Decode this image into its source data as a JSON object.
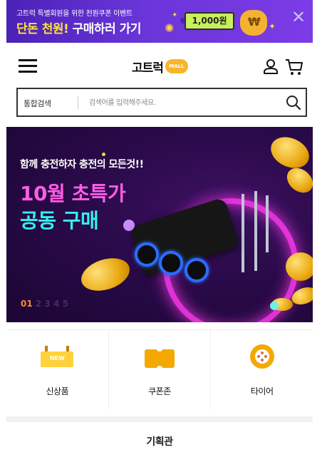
{
  "promo": {
    "sub": "고트럭 특별회원을 위한 천원쿠폰 이벤트",
    "main_prefix": "단돈 천원!",
    "main_suffix": " 구매하러 가기",
    "coupon_amount": "1,000원",
    "close_icon": "close-icon"
  },
  "header": {
    "logo_text": "고트럭",
    "logo_badge": "MALL",
    "icons": [
      "menu-icon",
      "user-icon",
      "cart-icon"
    ]
  },
  "search": {
    "scope": "통합검색",
    "placeholder": "검색어를 입력해주세요.",
    "value": "",
    "icon": "search-icon"
  },
  "hero": {
    "tagline": "함께 충전하자 충전의 모든것!!",
    "title_line1": "10월 초특가",
    "title_line2": "공동 구매",
    "pager_current": "01",
    "pager_rest": "2 3 4 5",
    "colors": {
      "title1": "#ff5de7",
      "title2": "#34f0ee",
      "ring": "#ff3af0",
      "pager": "#ff8a2a"
    }
  },
  "categories": [
    {
      "label": "신상품",
      "icon": "new-icon",
      "badge": "NEW"
    },
    {
      "label": "쿠폰존",
      "icon": "coupon-icon"
    },
    {
      "label": "타이어",
      "icon": "tire-icon"
    }
  ],
  "special": {
    "label": "기획관"
  },
  "accent_colors": {
    "brand_yellow": "#f5a800",
    "promo_purple": "#5a2bcc"
  }
}
